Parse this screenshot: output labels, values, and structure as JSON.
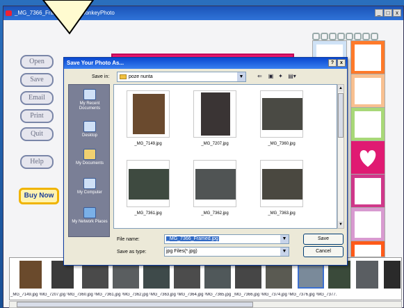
{
  "app": {
    "title": "_MG_7366_Fram",
    "title_tail": "MonkeyPhoto",
    "min": "_",
    "max": "□",
    "close": "x"
  },
  "left_buttons": [
    "Open",
    "Save",
    "Email",
    "Print",
    "Quit",
    "Help"
  ],
  "buy_now": "Buy Now",
  "dialog": {
    "title": "Save Your Photo As...",
    "help": "?",
    "close": "x",
    "save_in_label": "Save in:",
    "save_in_value": "poze nunta",
    "toolbar_icons": [
      "back-icon",
      "up-folder-icon",
      "new-folder-icon",
      "views-icon"
    ],
    "places": [
      "My Recent Documents",
      "Desktop",
      "My Documents",
      "My Computer",
      "My Network Places"
    ],
    "files": [
      "_MG_7149.jpg",
      "_MG_7207.jpg",
      "_MG_7360.jpg",
      "_MG_7361.jpg",
      "_MG_7362.jpg",
      "_MG_7363.jpg"
    ],
    "file_name_label": "File name:",
    "file_name_value": "_MG_7366_Framed.jpg",
    "save_as_type_label": "Save as type:",
    "save_as_type_value": "jpg Files(*.jpg)",
    "save_button": "Save",
    "cancel_button": "Cancel"
  },
  "filmstrip": {
    "names": "_MG_7149.jpg  ¹MG_7207.jpg  ¹MG_7360.jpg  ¹MG_7361.jpg  ¹MG_7362.jpg  ¹MG_7363.jpg  ¹MG_7364.jpg  ¹MG_7365.jpg  _MG_7366.jpg  ¹MG_7374.jpg  ¹MG_7376.jpg  ¹MG_7377."
  },
  "colors": {
    "banner": "#e8186e",
    "title_bar": "#2f73d8",
    "buy_now_border": "#f0b400"
  }
}
